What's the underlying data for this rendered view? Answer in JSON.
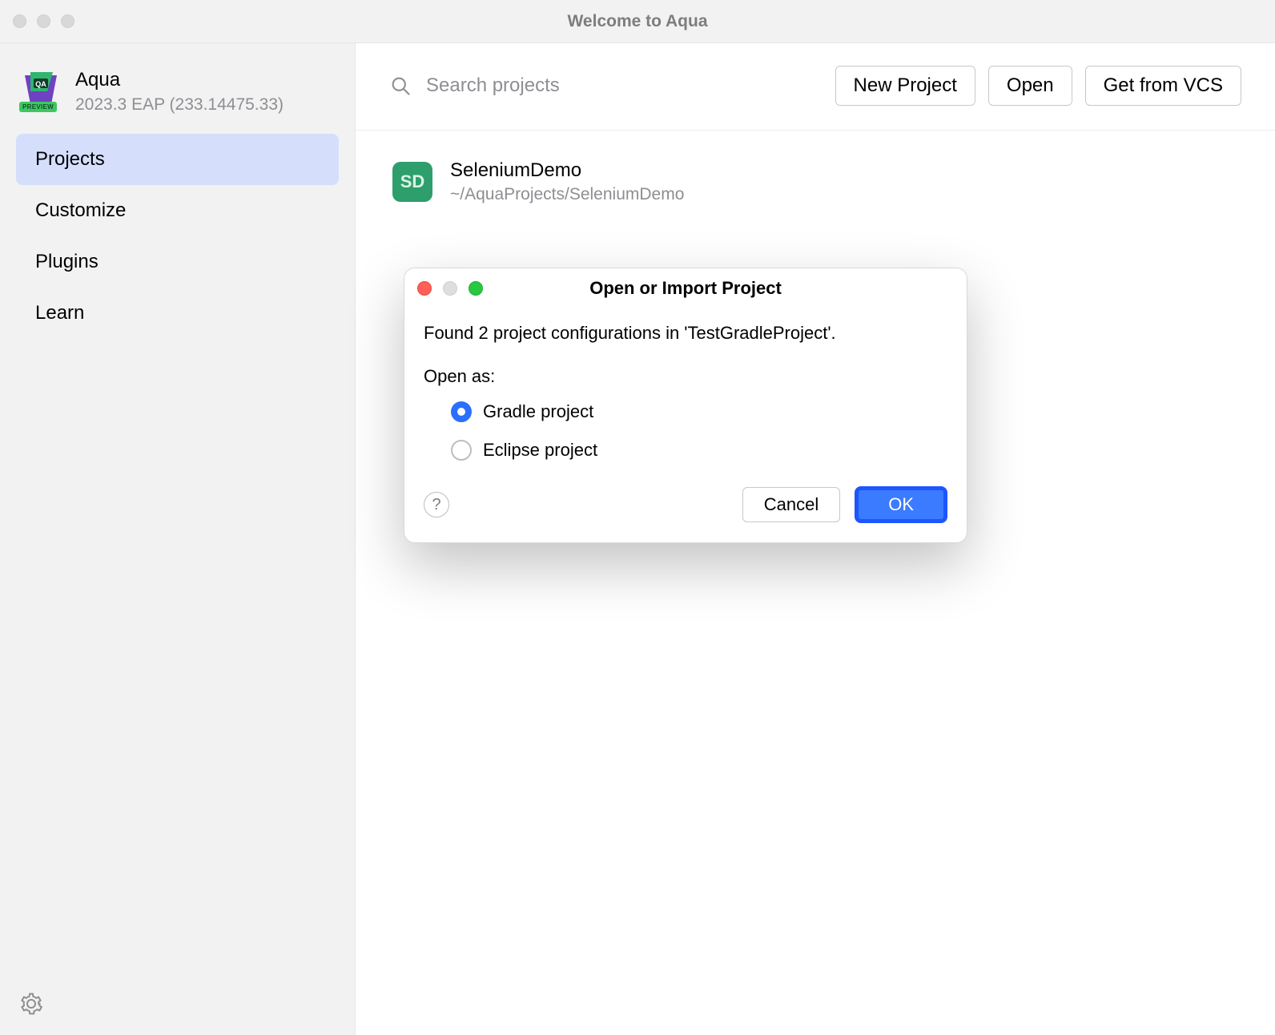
{
  "window": {
    "title": "Welcome to Aqua"
  },
  "product": {
    "name": "Aqua",
    "version": "2023.3 EAP (233.14475.33)",
    "badge": "PREVIEW"
  },
  "sidebar": {
    "items": [
      {
        "label": "Projects",
        "active": true
      },
      {
        "label": "Customize",
        "active": false
      },
      {
        "label": "Plugins",
        "active": false
      },
      {
        "label": "Learn",
        "active": false
      }
    ]
  },
  "toolbar": {
    "search_placeholder": "Search projects",
    "buttons": {
      "new_project": "New Project",
      "open": "Open",
      "get_from_vcs": "Get from VCS"
    }
  },
  "projects": [
    {
      "initials": "SD",
      "name": "SeleniumDemo",
      "path": "~/AquaProjects/SeleniumDemo"
    }
  ],
  "dialog": {
    "title": "Open or Import Project",
    "message": "Found 2 project configurations in 'TestGradleProject'.",
    "open_as_label": "Open as:",
    "options": [
      {
        "label": "Gradle project",
        "selected": true
      },
      {
        "label": "Eclipse project",
        "selected": false
      }
    ],
    "buttons": {
      "help": "?",
      "cancel": "Cancel",
      "ok": "OK"
    }
  }
}
